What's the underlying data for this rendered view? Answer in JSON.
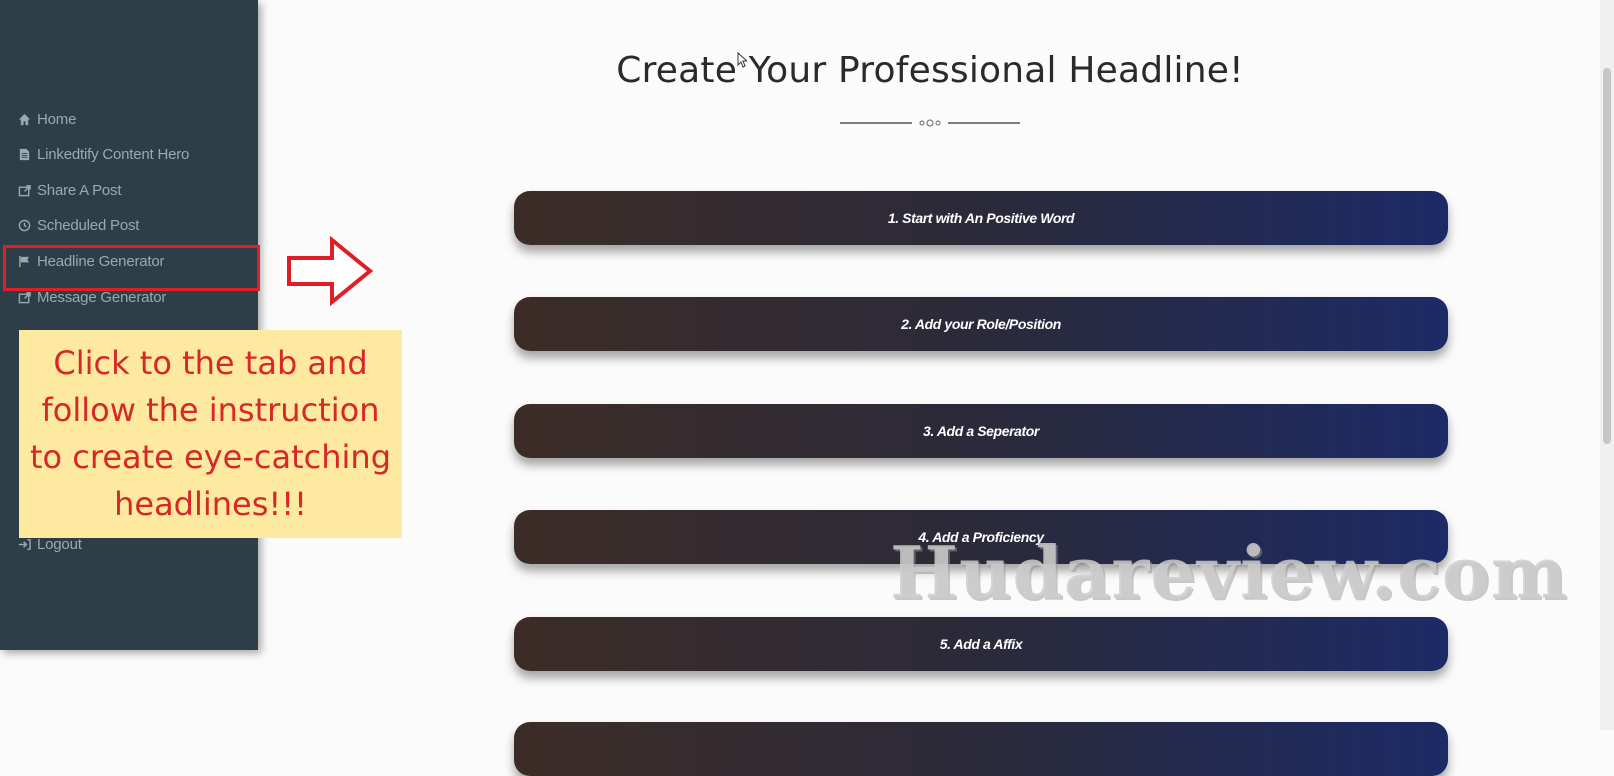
{
  "sidebar": {
    "items": [
      {
        "label": "Home",
        "icon": "home-icon"
      },
      {
        "label": "Linkedtify Content Hero",
        "icon": "document-icon"
      },
      {
        "label": "Share A Post",
        "icon": "share-icon"
      },
      {
        "label": "Scheduled Post",
        "icon": "clock-icon"
      },
      {
        "label": "Headline Generator",
        "icon": "flag-icon"
      },
      {
        "label": "Message Generator",
        "icon": "message-icon"
      },
      {
        "label": "Logout",
        "icon": "logout-icon"
      }
    ]
  },
  "annotation": {
    "note": "Click to the tab and follow the instruction to create eye-catching headlines!!!",
    "arrow_icon": "right-arrow-icon",
    "highlight_color": "#e01e25",
    "note_background": "#fde9a0"
  },
  "main": {
    "title": "Create Your Professional Headline!",
    "steps": [
      {
        "label": "1. Start with An Positive Word"
      },
      {
        "label": "2. Add your Role/Position"
      },
      {
        "label": "3. Add a Seperator"
      },
      {
        "label": "4. Add a Proficiency"
      },
      {
        "label": "5. Add a Affix"
      }
    ]
  },
  "watermark": "Hudareview.com",
  "colors": {
    "sidebar": "#2e3e49",
    "step_gradient_start": "#3c2c27",
    "step_gradient_end": "#1c2a66"
  }
}
